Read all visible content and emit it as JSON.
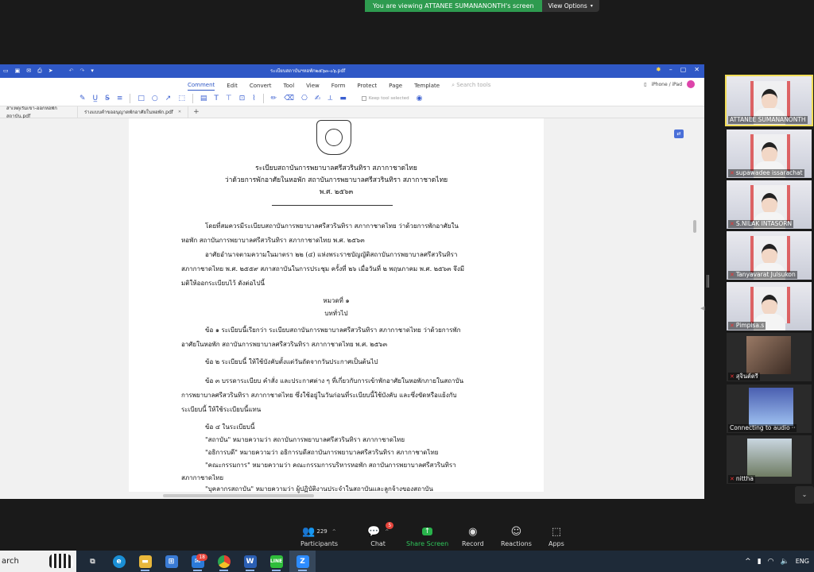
{
  "banner": {
    "viewing_text": "You are viewing ATTANEE SUMANANONTH's screen",
    "view_options": "View Options"
  },
  "pdf_app": {
    "window_title": "ระเบียบสถาบันฯหอพัก๒๕๖๓-๐๖.pdf",
    "menus": [
      "Comment",
      "Edit",
      "Convert",
      "Tool",
      "View",
      "Form",
      "Protect",
      "Page",
      "Template"
    ],
    "search_placeholder": "Search tools",
    "device_label": "iPhone / iPad",
    "keep_tool_selected": "Keep tool selected",
    "tabs": [
      {
        "label": "สาเหตุเริ่มเข้า-ออกหอพักสถาบัน.pdf"
      },
      {
        "label": "ร่างแบบคำขออนุญาตพักอาศัยในหอพัก.pdf"
      }
    ],
    "document": {
      "title_lines": [
        "ระเบียบสถาบันการพยาบาลศรีสวรินทิรา สภากาชาดไทย",
        "ว่าด้วยการพักอาศัยในหอพัก สถาบันการพยาบาลศรีสวรินทิรา สภากาชาดไทย",
        "พ.ศ. ๒๕๖๓"
      ],
      "body_lines": [
        "โดยที่สมควรมีระเบียบสถาบันการพยาบาลศรีสวรินทิรา สภากาชาดไทย ว่าด้วยการพักอาศัยใน",
        "หอพัก สถาบันการพยาบาลศรีสวรินทิรา สภากาชาดไทย พ.ศ. ๒๕๖๓",
        "อาศัยอำนาจตามความในมาตรา ๒๒ (๔) แห่งพระราชบัญญัติสถาบันการพยาบาลศรีสวรินทิรา",
        "สภากาชาดไทย พ.ศ. ๒๕๕๙ สภาสถาบันในการประชุม ครั้งที่ ๒๖ เมื่อวันที่ ๒ พฤษภาคม พ.ศ. ๒๕๖๓ จึงมี",
        "มติให้ออกระเบียบไว้ ดังต่อไปนี้"
      ],
      "chapter": "หมวดที่ ๑",
      "chapter_title": "บททั่วไป",
      "clauses": [
        "ข้อ ๑ ระเบียบนี้เรียกว่า ระเบียบสถาบันการพยาบาลศรีสวรินทิรา สภากาชาดไทย ว่าด้วยการพัก",
        "อาศัยในหอพัก สถาบันการพยาบาลศรีสวรินทิรา สภากาชาดไทย พ.ศ. ๒๕๖๓",
        "ข้อ ๒ ระเบียบนี้ ให้ใช้บังคับตั้งแต่วันถัดจากวันประกาศเป็นต้นไป",
        "ข้อ ๓ บรรดาระเบียบ คำสั่ง และประกาศต่าง ๆ ที่เกี่ยวกับการเข้าพักอาศัยในหอพักภายในสถาบัน",
        "การพยาบาลศรีสวรินทิรา สภากาชาดไทย ซึ่งใช้อยู่ในวันก่อนที่ระเบียบนี้ใช้บังคับ และซึ่งขัดหรือแย้งกับ",
        "ระเบียบนี้ ให้ใช้ระเบียบนี้แทน",
        "ข้อ ๔ ในระเบียบนี้",
        "\"สถาบัน\" หมายความว่า สถาบันการพยาบาลศรีสวรินทิรา สภากาชาดไทย",
        "\"อธิการบดี\" หมายความว่า อธิการบดีสถาบันการพยาบาลศรีสวรินทิรา สภากาชาดไทย",
        "\"คณะกรรมการ\" หมายความว่า คณะกรรมการบริหารหอพัก สถาบันการพยาบาลศรีสวรินทิรา",
        "สภากาชาดไทย",
        "\"บุคลากรสถาบัน\" หมายความว่า ผู้ปฏิบัติงานประจำในสถาบันและลูกจ้างของสถาบัน"
      ]
    }
  },
  "participants": [
    {
      "name": "ATTANEE SUMANANONTH",
      "muted": false,
      "type": "photo"
    },
    {
      "name": "supawadee issarachat",
      "muted": true,
      "type": "photo"
    },
    {
      "name": "S.NILAK INTASORN",
      "muted": true,
      "type": "photo"
    },
    {
      "name": "Tanyavarat Julsukon",
      "muted": true,
      "type": "photo"
    },
    {
      "name": "Pimpisa.s",
      "muted": true,
      "type": "photo"
    },
    {
      "name": "สุจินต์ตรี",
      "muted": true,
      "type": "thumb"
    },
    {
      "name": "Connecting to audio",
      "muted": false,
      "type": "thumb"
    },
    {
      "name": "nittha",
      "muted": true,
      "type": "thumb"
    }
  ],
  "zoom_controls": {
    "participants_label": "Participants",
    "participants_count": "229",
    "chat_label": "Chat",
    "chat_badge": "5",
    "share_label": "Share Screen",
    "record_label": "Record",
    "reactions_label": "Reactions",
    "apps_label": "Apps"
  },
  "taskbar": {
    "search_text": "arch",
    "mail_badge": "18",
    "tray_lang": "ENG",
    "icons": [
      "task-view-icon",
      "edge-icon",
      "file-explorer-icon",
      "store-icon",
      "mail-icon",
      "chrome-icon",
      "word-icon",
      "line-icon",
      "zoom-icon"
    ]
  }
}
